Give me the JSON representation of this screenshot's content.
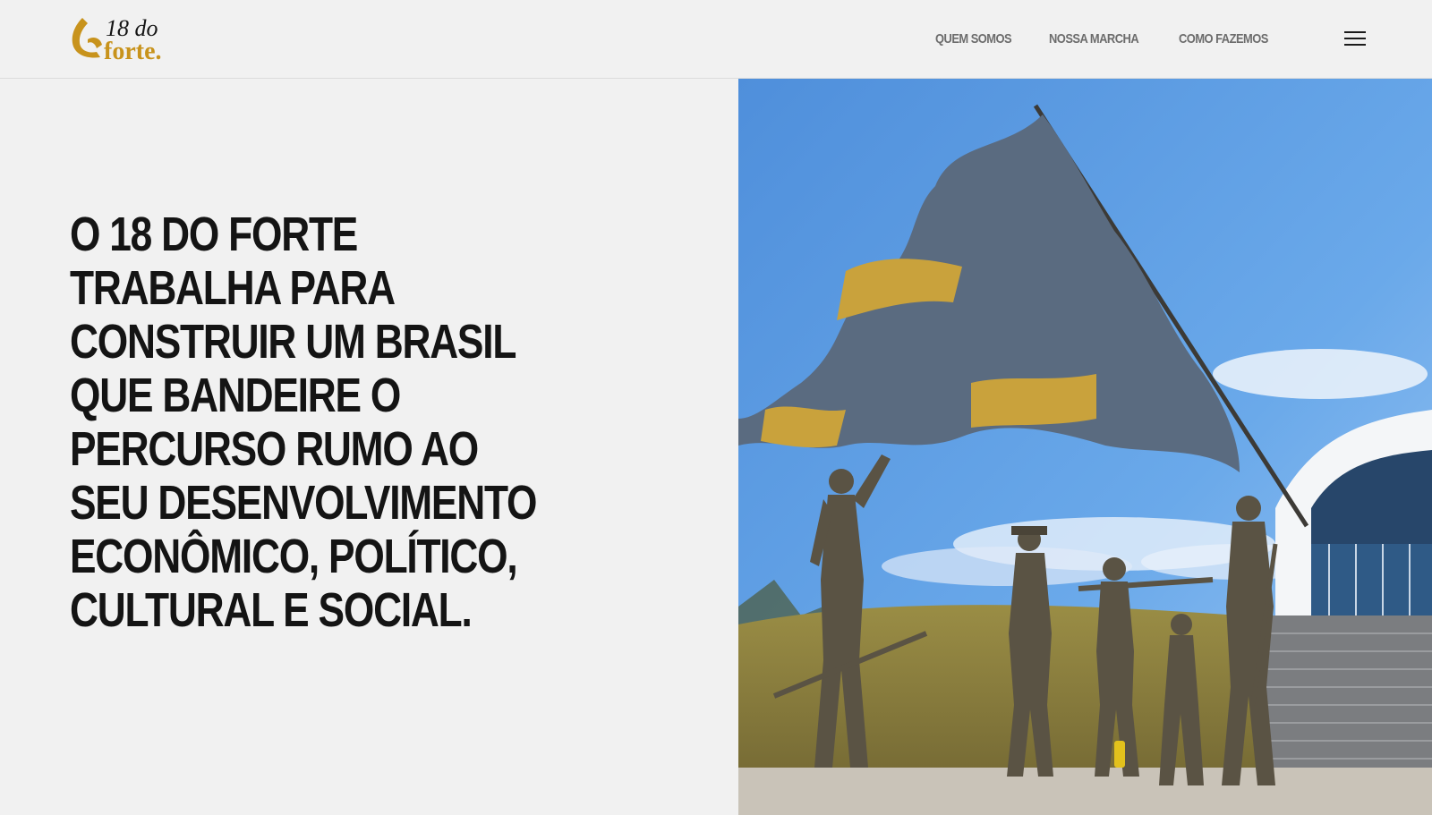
{
  "brand": {
    "logo_line1": "18 do",
    "logo_line2": "forte.",
    "colors": {
      "gold": "#c8931c",
      "dark": "#141414"
    }
  },
  "nav": {
    "items": [
      {
        "label": "QUEM SOMOS"
      },
      {
        "label": "NOSSA MARCHA"
      },
      {
        "label": "COMO FAZEMOS"
      }
    ],
    "menu_icon": "hamburger-icon"
  },
  "hero": {
    "title_lines": [
      "O 18 DO FORTE",
      "TRABALHA PARA",
      "CONSTRUIR UM BRASIL",
      "QUE BANDEIRE O",
      "PERCURSO RUMO AO",
      "SEU DESENVOLVIMENTO",
      "ECONÔMICO, POLÍTICO,",
      "CULTURAL E SOCIAL."
    ]
  },
  "photo": {
    "subject": "statues-with-flag-photo",
    "colors": {
      "sky": "#5f9fe0",
      "grass": "#8a7d3e",
      "flag_blue": "#5a6b80",
      "flag_gold": "#c9a23c",
      "statue": "#5a5344"
    }
  }
}
